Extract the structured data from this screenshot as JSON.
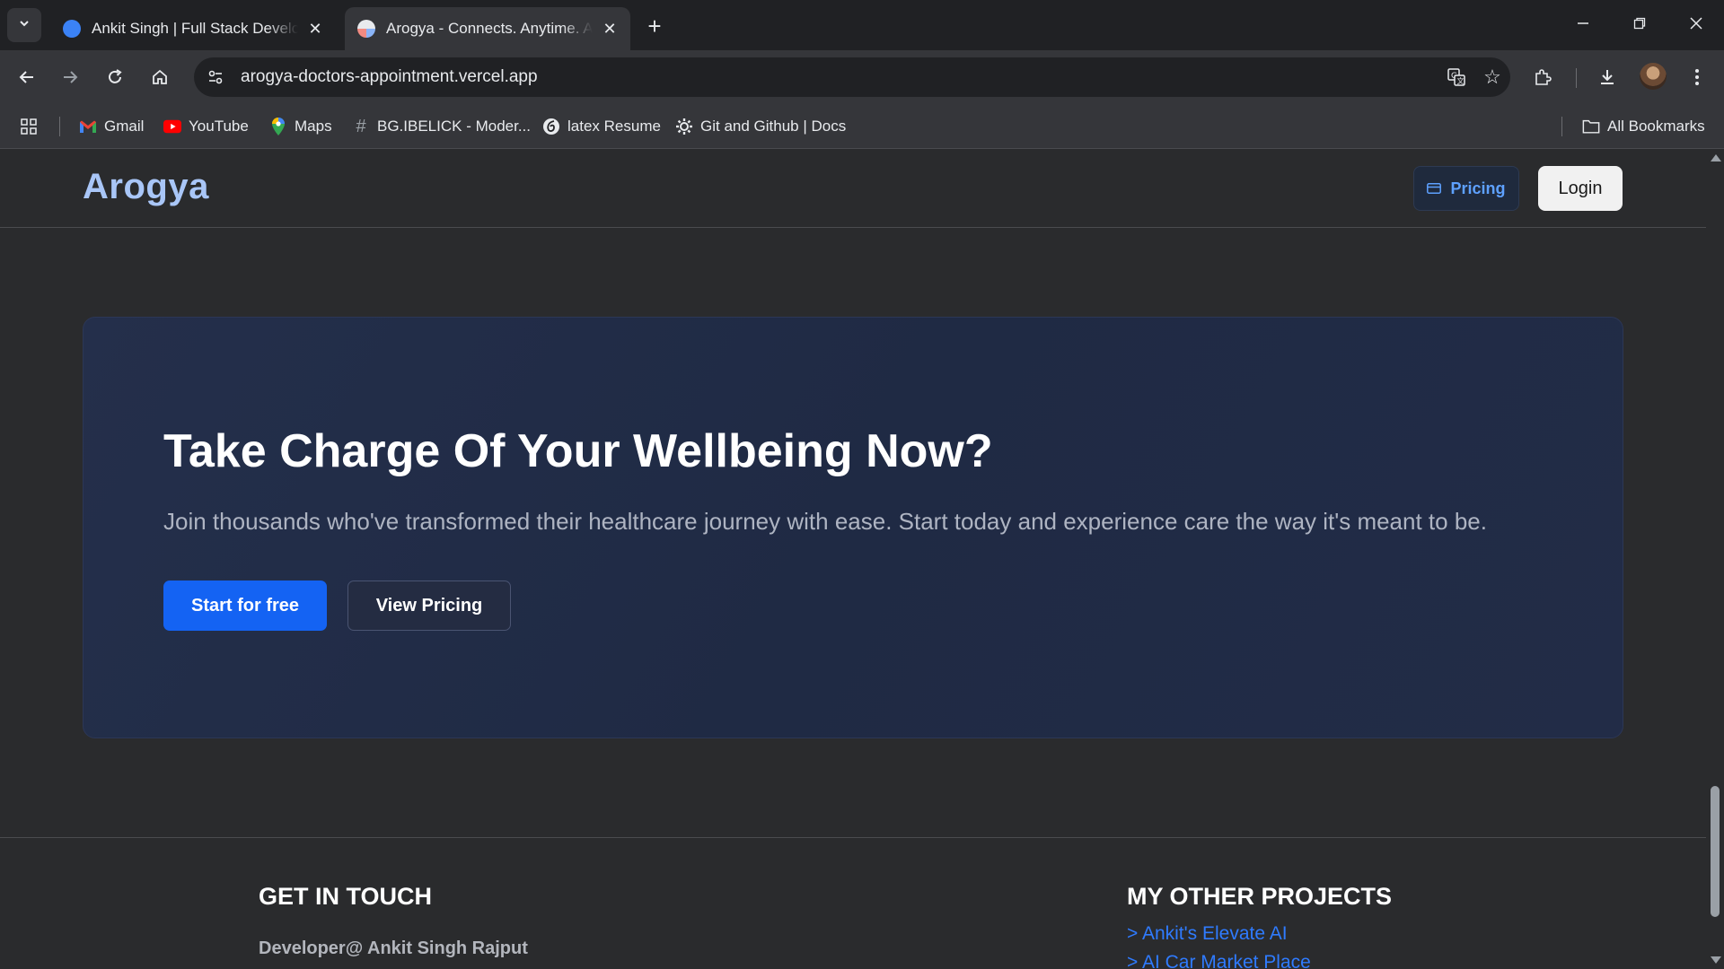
{
  "browser": {
    "tabs": [
      {
        "title": "Ankit Singh | Full Stack Developer",
        "active": false,
        "favicon": "portfolio-favicon"
      },
      {
        "title": "Arogya - Connects. Anytime. Anywhere.",
        "active": true,
        "favicon": "arogya-favicon"
      }
    ],
    "url": "arogya-doctors-appointment.vercel.app",
    "bookmarks": [
      {
        "label": "Gmail",
        "icon": "gmail-icon"
      },
      {
        "label": "YouTube",
        "icon": "youtube-icon"
      },
      {
        "label": "Maps",
        "icon": "maps-icon"
      },
      {
        "label": "BG.IBELICK - Moder...",
        "icon": "hash-icon"
      },
      {
        "label": "latex Resume",
        "icon": "overleaf-icon"
      },
      {
        "label": "Git and Github | Docs",
        "icon": "gear-icon"
      }
    ],
    "all_bookmarks_label": "All Bookmarks"
  },
  "site": {
    "logo": "Arogya",
    "pricing_label": "Pricing",
    "login_label": "Login"
  },
  "cta": {
    "title": "Take Charge Of Your Wellbeing Now?",
    "subtitle": "Join thousands who've transformed their healthcare journey with ease. Start today and experience care the way it's meant to be.",
    "primary_label": "Start for free",
    "secondary_label": "View Pricing"
  },
  "footer": {
    "contact_heading": "GET IN TOUCH",
    "developer": "Developer@ Ankit Singh Rajput",
    "projects_heading": "MY OTHER PROJECTS",
    "projects": [
      "> Ankit's Elevate AI",
      "> AI Car Market Place"
    ]
  },
  "colors": {
    "accent": "#1463f3",
    "logo": "#a9c6f7",
    "link": "#2f7bff",
    "card": "#222c47"
  }
}
